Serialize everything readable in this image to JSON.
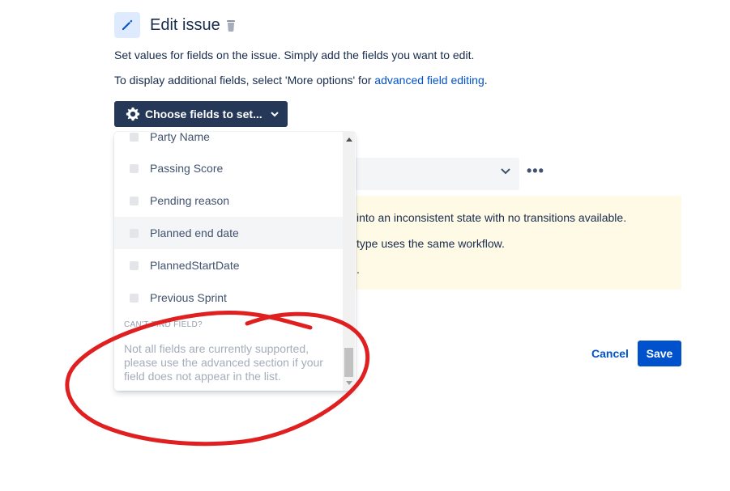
{
  "header": {
    "title": "Edit issue",
    "icon": "pencil-icon",
    "delete_icon": "trash-icon"
  },
  "description": {
    "line1": "Set values for fields on the issue. Simply add the fields you want to edit.",
    "line2_prefix": "To display additional fields, select 'More options' for ",
    "line2_link": "advanced field editing",
    "line2_suffix": "."
  },
  "choose_button": {
    "label": "Choose fields to set...",
    "icon": "gear-icon"
  },
  "dropdown": {
    "items": [
      {
        "label": "Party Name"
      },
      {
        "label": "Passing Score"
      },
      {
        "label": "Pending reason"
      },
      {
        "label": "Planned end date",
        "hovered": true
      },
      {
        "label": "PlannedStartDate"
      },
      {
        "label": "Previous Sprint"
      }
    ],
    "cant_find_heading": "CAN'T FIND FIELD?",
    "cant_find_note": "Not all fields are currently supported, please use the advanced section if your field does not appear in the list."
  },
  "warning": {
    "line1": "into an inconsistent state with no transitions available.",
    "line2": "type uses the same workflow.",
    "line3": "."
  },
  "footer": {
    "cancel_label": "Cancel",
    "save_label": "Save"
  },
  "colors": {
    "primary": "#0052cc",
    "button_dark": "#253858",
    "warning_bg": "#fffae6",
    "annotation_red": "#e02020"
  }
}
